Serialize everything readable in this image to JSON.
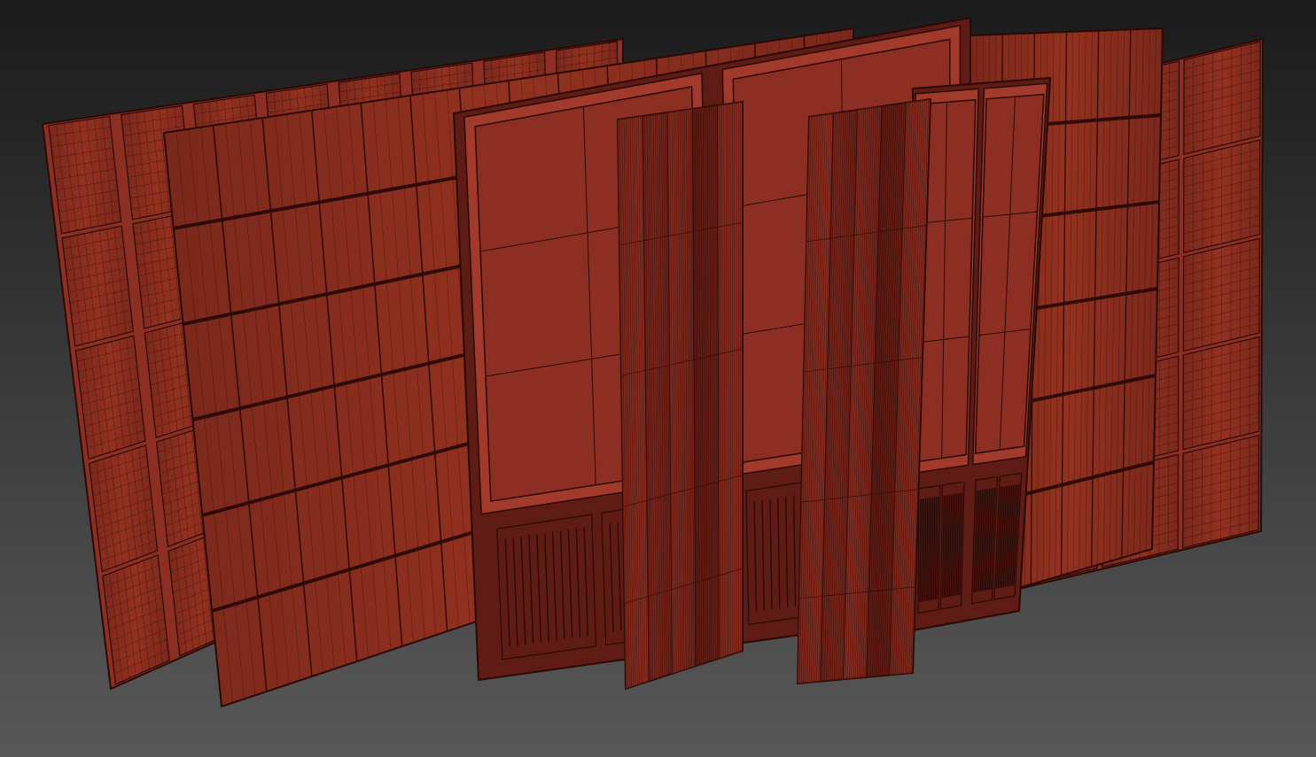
{
  "viewport": {
    "label": "",
    "background": {
      "top": "#1b1b1b",
      "bottom": "#585858"
    }
  },
  "material": {
    "base": "#8c2f22",
    "highlight": "#a13a2b",
    "shade": "#5e1c14",
    "wire": "#2b0a06"
  },
  "scene": {
    "objects": [
      "back-wall-panel-with-square-tiles",
      "horizontal-plank-wall-panel",
      "right-wall-panel-with-square-tiles",
      "right-plank-wall-panel",
      "left-double-door-panel",
      "right-double-door-panel",
      "left-curtain",
      "right-curtain"
    ]
  }
}
